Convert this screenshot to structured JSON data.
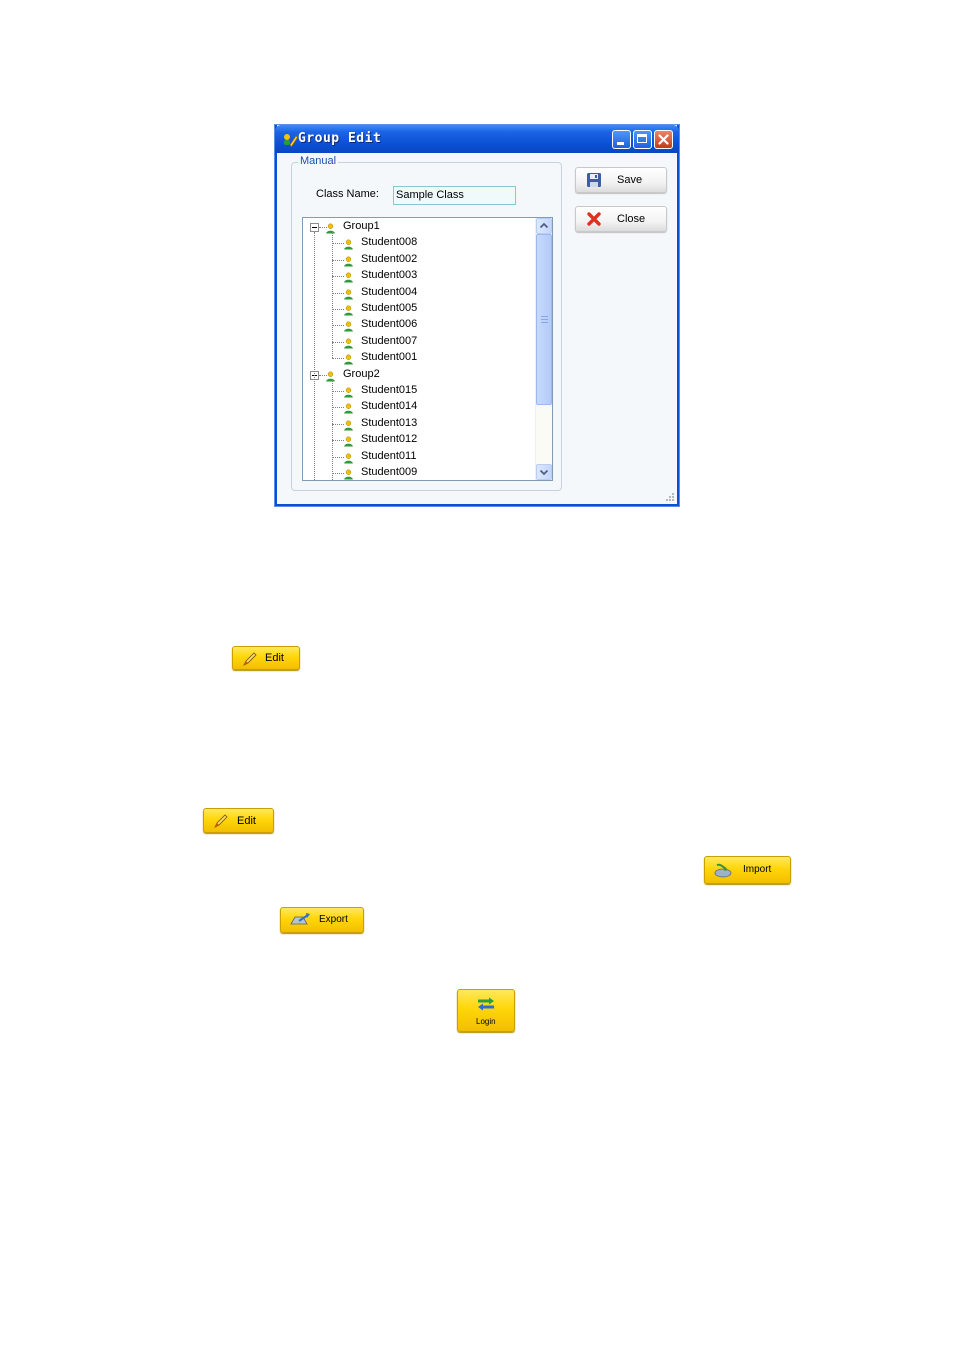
{
  "dialog": {
    "title": "Group Edit",
    "group_label": "Manual",
    "class_name_label": "Class Name:",
    "class_name_value": "Sample Class",
    "save_label": "Save",
    "close_label": "Close",
    "tree": [
      {
        "label": "Group1",
        "children": [
          "Student008",
          "Student002",
          "Student003",
          "Student004",
          "Student005",
          "Student006",
          "Student007",
          "Student001"
        ]
      },
      {
        "label": "Group2",
        "children": [
          "Student015",
          "Student014",
          "Student013",
          "Student012",
          "Student011",
          "Student009"
        ]
      }
    ]
  },
  "buttons": {
    "edit_1": "Edit",
    "edit_2": "Edit",
    "import": "Import",
    "export": "Export",
    "login": "Login"
  },
  "colors": {
    "title_bar": "#0a4fd4",
    "yellow_button": "#ffd60a",
    "close_x": "#e0301e"
  },
  "icons": {
    "window": "group-edit-icon",
    "save": "floppy-disk-icon",
    "close": "red-x-icon",
    "tree_node": "person-icon"
  }
}
